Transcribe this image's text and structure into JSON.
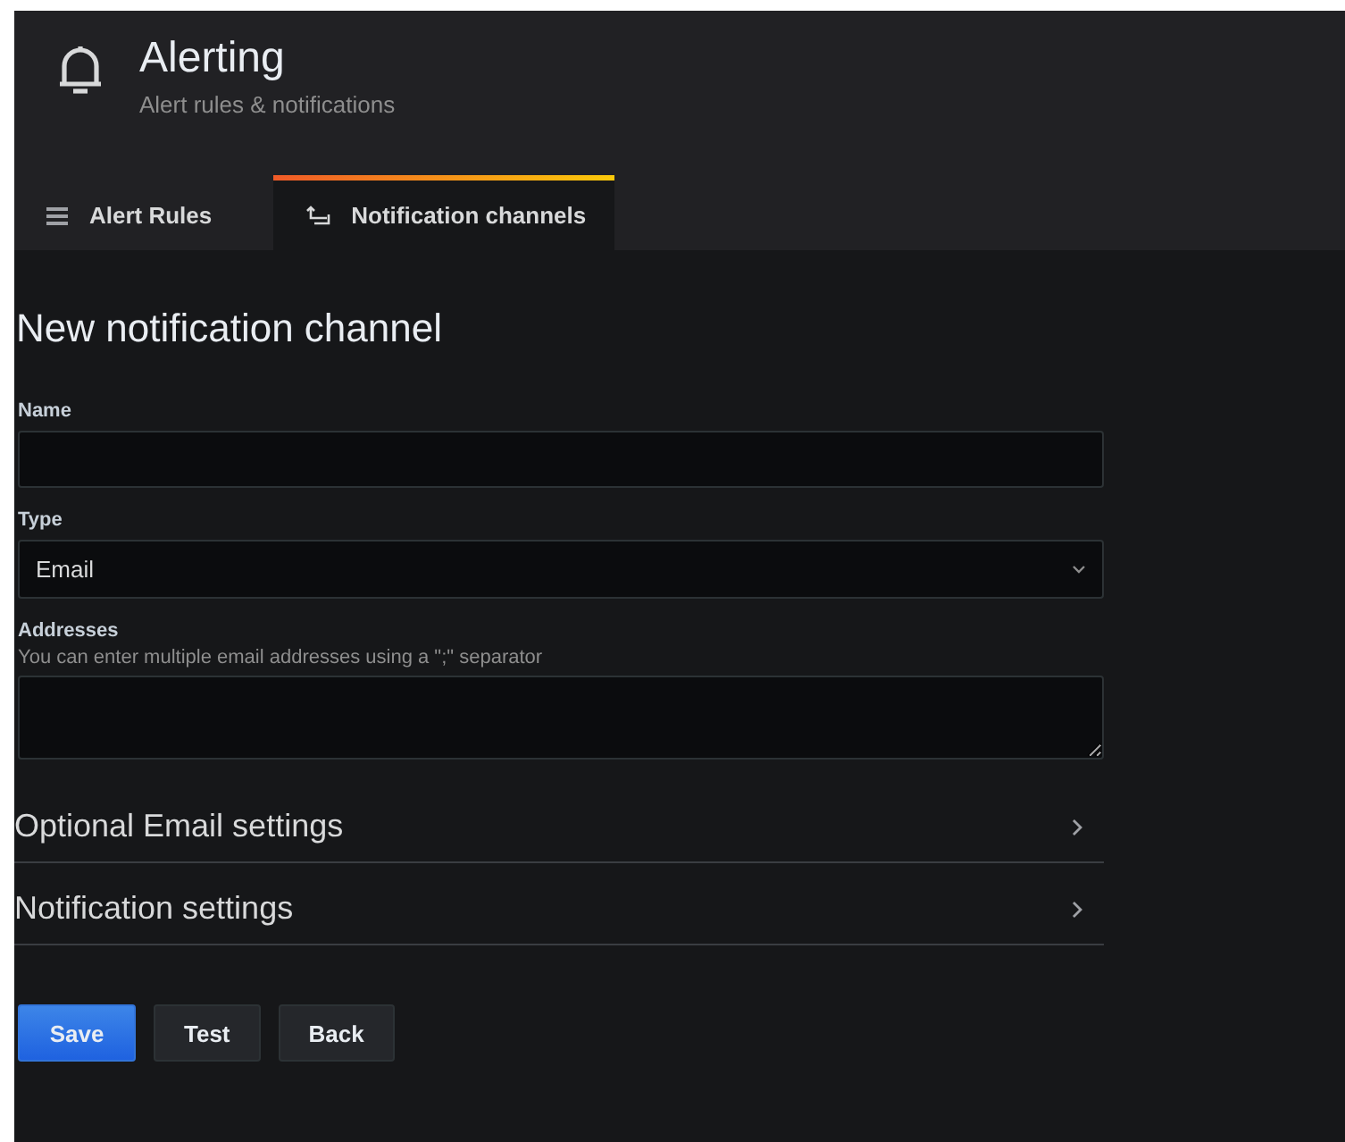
{
  "header": {
    "title": "Alerting",
    "subtitle": "Alert rules & notifications"
  },
  "tabs": [
    {
      "label": "Alert Rules",
      "selected": false
    },
    {
      "label": "Notification channels",
      "selected": true
    }
  ],
  "page_title": "New notification channel",
  "fields": [
    {
      "kind": "input",
      "label": "Name"
    },
    {
      "kind": "select",
      "label": "Type",
      "value": "Email"
    },
    {
      "kind": "textarea",
      "label": "Addresses",
      "description": "You can enter multiple email addresses using a \";\" separator"
    }
  ],
  "sections": [
    {
      "title": "Optional Email settings",
      "expanded": false
    },
    {
      "title": "Notification settings",
      "expanded": false
    }
  ],
  "buttons": [
    {
      "label": "Save",
      "kind": "primary"
    },
    {
      "label": "Test",
      "kind": "secondary"
    },
    {
      "label": "Back",
      "kind": "secondary"
    }
  ]
}
